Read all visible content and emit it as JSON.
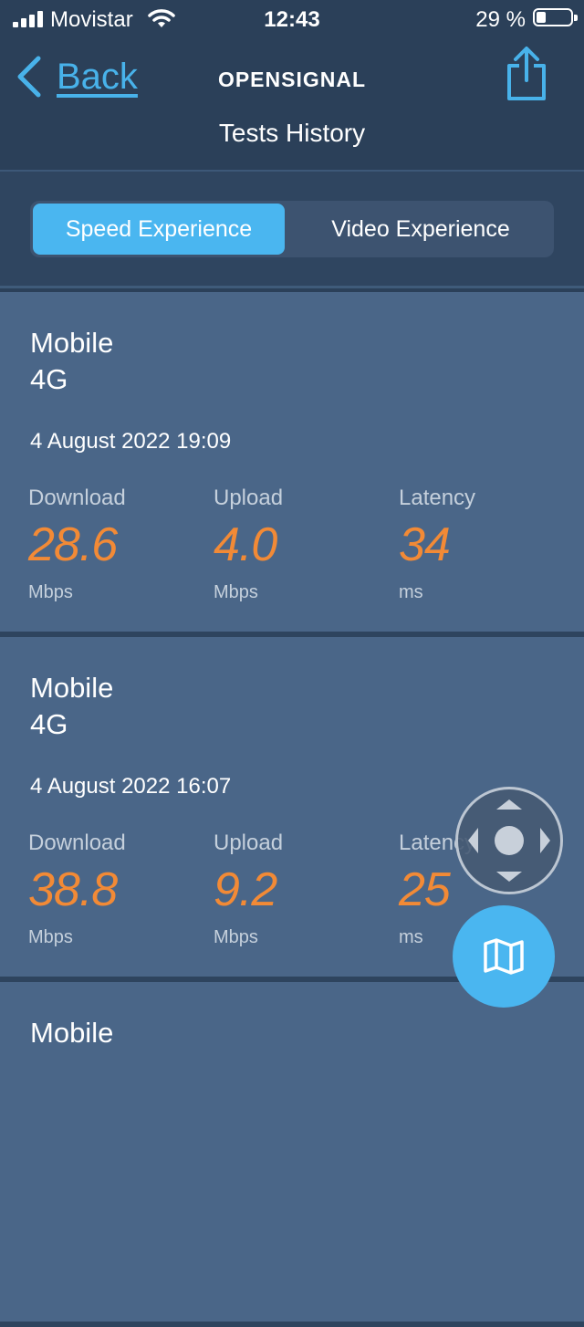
{
  "status_bar": {
    "carrier": "Movistar",
    "time": "12:43",
    "battery": "29 %",
    "battery_level": 0.29
  },
  "nav": {
    "back_label": "Back",
    "logo_text": "OPENSIGNAL",
    "title": "Tests History",
    "share_icon": "share-icon"
  },
  "segments": {
    "speed": "Speed Experience",
    "video": "Video Experience",
    "active": "speed"
  },
  "tests": [
    {
      "type": "Mobile",
      "network": "4G",
      "datetime": "4 August 2022 19:09",
      "download_label": "Download",
      "download": "28.6",
      "download_unit": "Mbps",
      "upload_label": "Upload",
      "upload": "4.0",
      "upload_unit": "Mbps",
      "latency_label": "Latency",
      "latency": "34",
      "latency_unit": "ms"
    },
    {
      "type": "Mobile",
      "network": "4G",
      "datetime": "4 August 2022 16:07",
      "download_label": "Download",
      "download": "38.8",
      "download_unit": "Mbps",
      "upload_label": "Upload",
      "upload": "9.2",
      "upload_unit": "Mbps",
      "latency_label": "Latency",
      "latency": "25",
      "latency_unit": "ms"
    },
    {
      "type": "Mobile"
    }
  ],
  "colors": {
    "accent": "#4ab6f0",
    "value": "#f28a36",
    "background": "#2b4059",
    "card": "#4a6688"
  }
}
